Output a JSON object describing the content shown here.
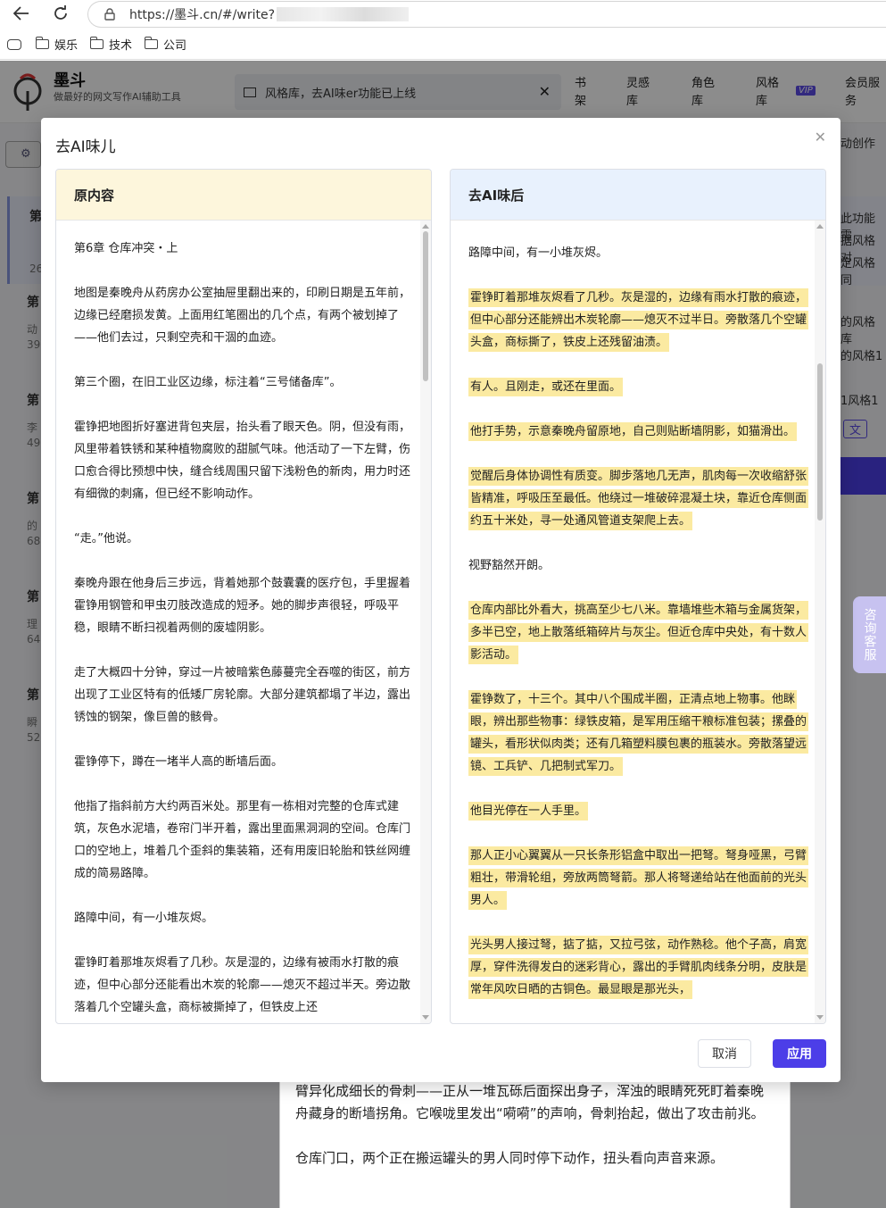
{
  "browser": {
    "url": "https://墨斗.cn/#/write?",
    "bookmarks": [
      "娱乐",
      "技术",
      "公司"
    ]
  },
  "site": {
    "name": "墨斗",
    "slogan": "做最好的网文写作AI辅助工具",
    "notice": "风格库，去AI味er功能已上线",
    "nav": [
      {
        "label": "书\n架"
      },
      {
        "label": "灵感\n库"
      },
      {
        "label": "角色\n库"
      },
      {
        "label": "风格\n库"
      },
      {
        "label": "会员服\n务"
      }
    ],
    "vip_label": "VIP",
    "side_chapters": [
      {
        "title": "第",
        "count": "26"
      },
      {
        "title": "第",
        "snippet": "动",
        "count": "39"
      },
      {
        "title": "第",
        "snippet": "李",
        "count": "49"
      },
      {
        "title": "第",
        "snippet": "的",
        "count": "68"
      },
      {
        "title": "第",
        "snippet": "理",
        "count": "64"
      },
      {
        "title": "第",
        "snippet": "瞬",
        "count": "52"
      }
    ],
    "right_fragments": [
      "动创作",
      "此功能需",
      "据风格对",
      "定风格同",
      "的风格库",
      "的风格1",
      "1风格1",
      "文"
    ],
    "float_service": "咨询客服",
    "editor_under_text": [
      "臂异化成细长的骨刺——正从一堆瓦砾后面探出身子，浑浊的眼睛死死盯着秦晚舟藏身的断墙拐角。它喉咙里发出“嗬嗬”的声响，骨刺抬起，做出了攻击前兆。",
      "仓库门口，两个正在搬运罐头的男人同时停下动作，扭头看向声音来源。"
    ]
  },
  "modal": {
    "title": "去AI味儿",
    "left_title": "原内容",
    "right_title": "去AI味后",
    "cancel": "取消",
    "apply": "应用",
    "original": [
      "第6章 仓库冲突・上",
      "地图是秦晚舟从药房办公室抽屉里翻出来的，印刷日期是五年前，边缘已经磨损发黄。上面用红笔圈出的几个点，有两个被划掉了——他们去过，只剩空壳和干涸的血迹。",
      "第三个圈，在旧工业区边缘，标注着“三号储备库”。",
      "霍铮把地图折好塞进背包夹层，抬头看了眼天色。阴，但没有雨，风里带着铁锈和某种植物腐败的甜腻气味。他活动了一下左臂，伤口愈合得比预想中快，缝合线周围只留下浅粉色的新肉，用力时还有细微的刺痛，但已经不影响动作。",
      "“走。”他说。",
      "秦晚舟跟在他身后三步远，背着她那个鼓囊囊的医疗包，手里握着霍铮用钢管和甲虫刃肢改造成的短矛。她的脚步声很轻，呼吸平稳，眼睛不断扫视着两侧的废墟阴影。",
      "走了大概四十分钟，穿过一片被暗紫色藤蔓完全吞噬的街区，前方出现了工业区特有的低矮厂房轮廓。大部分建筑都塌了半边，露出锈蚀的钢架，像巨兽的骸骨。",
      "霍铮停下，蹲在一堵半人高的断墙后面。",
      "他指了指斜前方大约两百米处。那里有一栋相对完整的仓库式建筑，灰色水泥墙，卷帘门半开着，露出里面黑洞洞的空间。仓库门口的空地上，堆着几个歪斜的集装箱，还有用废旧轮胎和铁丝网缠成的简易路障。",
      "路障中间，有一小堆灰烬。",
      "霍铮盯着那堆灰烬看了几秒。灰是湿的，边缘有被雨水打散的痕迹，但中心部分还能看出木炭的轮廓——熄灭不超过半天。旁边散落着几个空罐头盒，商标被撕掉了，但铁皮上还"
    ],
    "rewritten": [
      {
        "text": "路障中间，有一小堆灰烬。",
        "hl": false
      },
      {
        "text": "霍铮盯着那堆灰烬看了几秒。灰是湿的，边缘有雨水打散的痕迹，但中心部分还能辨出木炭轮廓——熄灭不过半日。旁散落几个空罐头盒，商标撕了，铁皮上还残留油渍。",
        "hl": true
      },
      {
        "text": "有人。且刚走，或还在里面。",
        "hl": true
      },
      {
        "text": "他打手势，示意秦晚舟留原地，自己则贴断墙阴影，如猫滑出。",
        "hl": true
      },
      {
        "text": "觉醒后身体协调性有质变。脚步落地几无声，肌肉每一次收缩舒张皆精准，呼吸压至最低。他绕过一堆破碎混凝土块，靠近仓库侧面约五十米处，寻一处通风管道支架爬上去。",
        "hl": true
      },
      {
        "text": "视野豁然开朗。",
        "hl": false
      },
      {
        "text": "仓库内部比外看大，挑高至少七八米。靠墙堆些木箱与金属货架，多半已空，地上散落纸箱碎片与灰尘。但近仓库中央处，有十数人影活动。",
        "hl": true
      },
      {
        "text": "霍铮数了，十三个。其中八个围成半圈，正清点地上物事。他眯眼，辨出那些物事：绿铁皮箱，是军用压缩干粮标准包装；摞叠的罐头，看形状似肉类；还有几箱塑料膜包裹的瓶装水。旁散落望远镜、工兵铲、几把制式军刀。",
        "hl": true
      },
      {
        "text": "他目光停在一人手里。",
        "hl": true
      },
      {
        "text": "那人正小心翼翼从一只长条形铝盒中取出一把弩。弩身哑黑，弓臂粗壮，带滑轮组，旁放两筒弩箭。那人将弩递给站在他面前的光头男人。",
        "hl": true
      },
      {
        "text": "光头男人接过弩，掂了掂，又拉弓弦，动作熟稔。他个子高，肩宽厚，穿件洗得发白的迷彩背心，露出的手臂肌肉线条分明，皮肤是常年风吹日晒的古铜色。最显眼是那光头，",
        "hl": true
      }
    ]
  }
}
